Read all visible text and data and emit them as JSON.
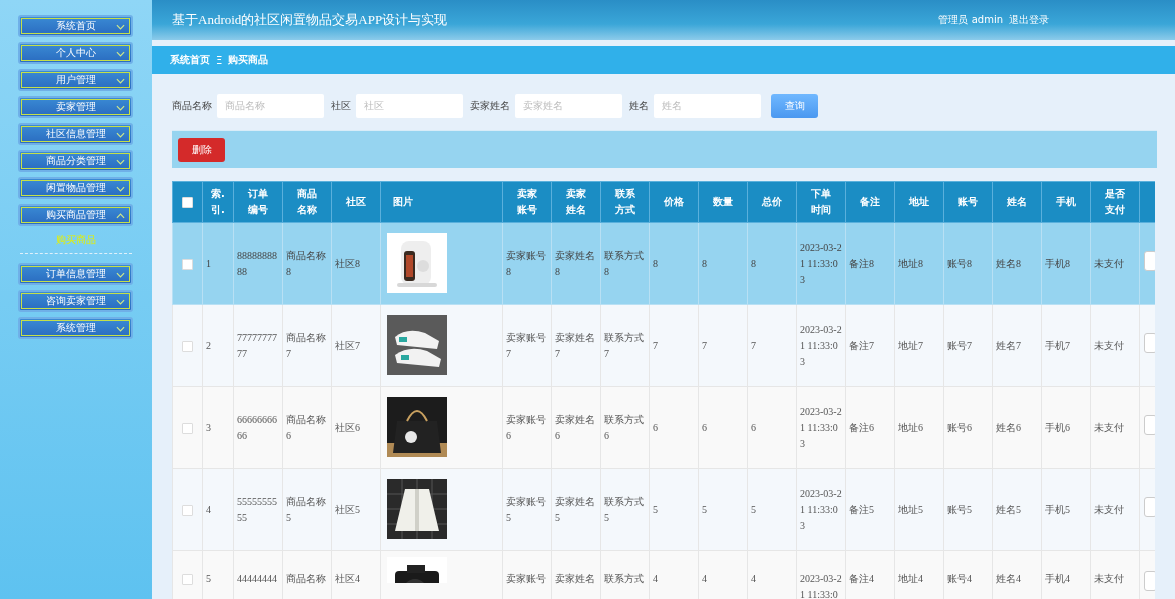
{
  "sidebar": {
    "items": [
      {
        "label": "系统首页",
        "expanded": false
      },
      {
        "label": "个人中心",
        "expanded": false
      },
      {
        "label": "用户管理",
        "expanded": false
      },
      {
        "label": "卖家管理",
        "expanded": false
      },
      {
        "label": "社区信息管理",
        "expanded": false
      },
      {
        "label": "商品分类管理",
        "expanded": false
      },
      {
        "label": "闲置物品管理",
        "expanded": false
      },
      {
        "label": "购买商品管理",
        "expanded": true,
        "children": [
          {
            "label": "购买商品",
            "selected": true
          }
        ]
      },
      {
        "label": "订单信息管理",
        "expanded": false
      },
      {
        "label": "咨询卖家管理",
        "expanded": false
      },
      {
        "label": "系统管理",
        "expanded": false
      }
    ]
  },
  "header": {
    "title": "基于Android的社区闲置物品交易APP设计与实现",
    "user": "管理员 admin",
    "logout": "退出登录"
  },
  "breadcrumb": [
    "系统首页",
    "购买商品"
  ],
  "breadcrumb_separator": "Ξ",
  "search": {
    "fields": [
      {
        "label": "商品名称",
        "placeholder": "商品名称"
      },
      {
        "label": "社区",
        "placeholder": "社区"
      },
      {
        "label": "卖家姓名",
        "placeholder": "卖家姓名"
      },
      {
        "label": "姓名",
        "placeholder": "姓名"
      }
    ],
    "button": "查询"
  },
  "toolbar": {
    "delete_button": "删除"
  },
  "table": {
    "header_checked": false,
    "columns": [
      {
        "label": "索.引.",
        "kind": "text"
      },
      {
        "label": "订单编号",
        "kind": "text"
      },
      {
        "label": "商品名称",
        "kind": "text"
      },
      {
        "label": "社区",
        "kind": "text"
      },
      {
        "label": "图片",
        "kind": "picture"
      },
      {
        "label": "卖家账号",
        "kind": "text"
      },
      {
        "label": "卖家姓名",
        "kind": "text"
      },
      {
        "label": "联系方式",
        "kind": "text"
      },
      {
        "label": "价格",
        "kind": "text"
      },
      {
        "label": "数量",
        "kind": "text"
      },
      {
        "label": "总价",
        "kind": "text"
      },
      {
        "label": "下单时间",
        "kind": "text"
      },
      {
        "label": "备注",
        "kind": "text"
      },
      {
        "label": "地址",
        "kind": "text"
      },
      {
        "label": "账号",
        "kind": "text"
      },
      {
        "label": "姓名",
        "kind": "text"
      },
      {
        "label": "手机",
        "kind": "text"
      },
      {
        "label": "是否支付",
        "kind": "text"
      }
    ],
    "rows": [
      {
        "selected": true,
        "checked": false,
        "cells": [
          "1",
          "8888888888",
          "商品名称8",
          "社区8",
          {
            "kind": "picture"
          },
          "卖家账号8",
          "卖家姓名8",
          "联系方式8",
          "8",
          "8",
          "8",
          "2023-03-21 11:33:03",
          "备注8",
          "地址8",
          "账号8",
          "姓名8",
          "手机8",
          "未支付"
        ]
      },
      {
        "selected": false,
        "checked": false,
        "cells": [
          "2",
          "7777777777",
          "商品名称7",
          "社区7",
          {
            "kind": "picture"
          },
          "卖家账号7",
          "卖家姓名7",
          "联系方式7",
          "7",
          "7",
          "7",
          "2023-03-21 11:33:03",
          "备注7",
          "地址7",
          "账号7",
          "姓名7",
          "手机7",
          "未支付"
        ]
      },
      {
        "selected": false,
        "checked": false,
        "cells": [
          "3",
          "6666666666",
          "商品名称6",
          "社区6",
          {
            "kind": "picture"
          },
          "卖家账号6",
          "卖家姓名6",
          "联系方式6",
          "6",
          "6",
          "6",
          "2023-03-21 11:33:03",
          "备注6",
          "地址6",
          "账号6",
          "姓名6",
          "手机6",
          "未支付"
        ]
      },
      {
        "selected": false,
        "checked": false,
        "cells": [
          "4",
          "5555555555",
          "商品名称5",
          "社区5",
          {
            "kind": "picture"
          },
          "卖家账号5",
          "卖家姓名5",
          "联系方式5",
          "5",
          "5",
          "5",
          "2023-03-21 11:33:03",
          "备注5",
          "地址5",
          "账号5",
          "姓名5",
          "手机5",
          "未支付"
        ]
      },
      {
        "selected": false,
        "checked": false,
        "cells": [
          "5",
          "44444444",
          "商品名称",
          "社区4",
          {
            "kind": "picture"
          },
          "卖家账号",
          "卖家姓名",
          "联系方式",
          "4",
          "4",
          "4",
          "2023-03-21 11:33:0",
          "备注4",
          "地址4",
          "账号4",
          "姓名4",
          "手机4",
          "未支付"
        ]
      }
    ]
  }
}
